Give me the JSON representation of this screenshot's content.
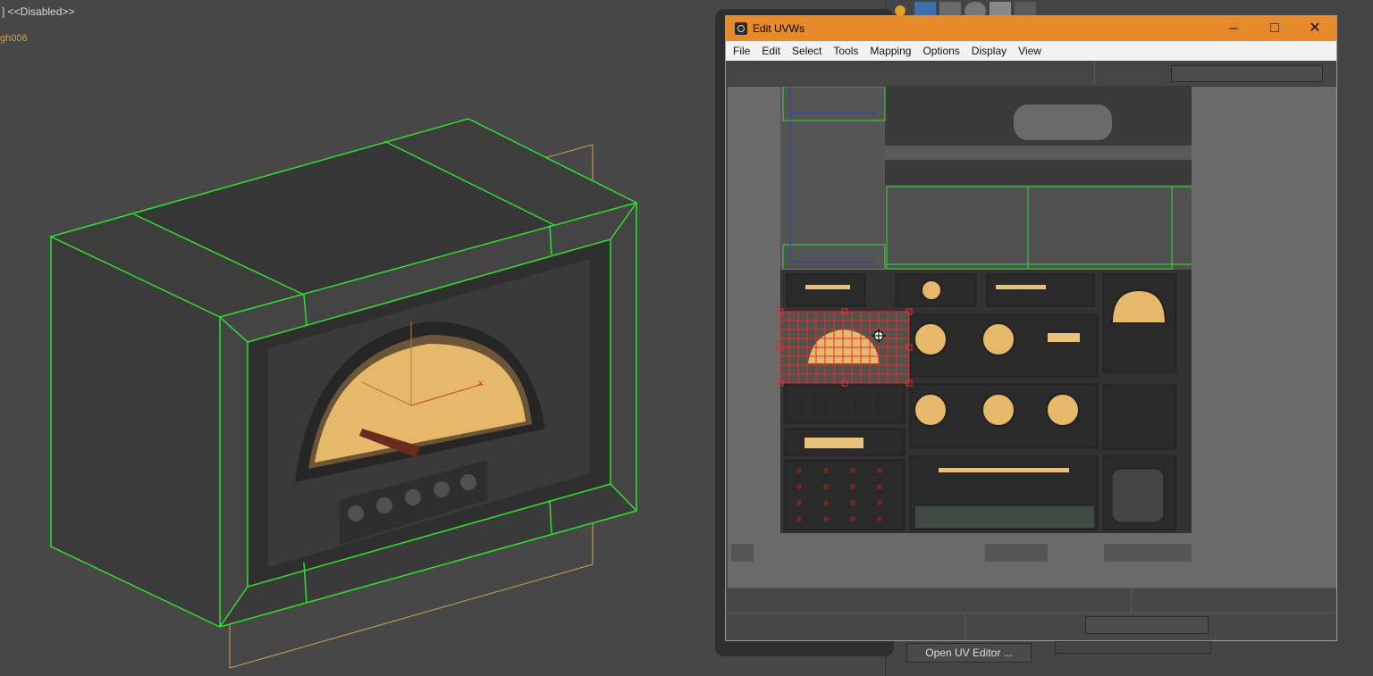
{
  "viewport": {
    "label": "] <<Disabled>>",
    "object_name": "gh006"
  },
  "uvw_window": {
    "title": "Edit UVWs",
    "buttons": {
      "minimize": "–",
      "maximize": "□",
      "close": "✕"
    },
    "menu": [
      "File",
      "Edit",
      "Select",
      "Tools",
      "Mapping",
      "Options",
      "Display",
      "View"
    ]
  },
  "command_panel": {
    "open_uv_editor": "Open UV Editor ..."
  },
  "colors": {
    "title_accent": "#e58b2b",
    "wireframe": "#33dd33",
    "selection": "#e03030",
    "gauge_face": "#e6b86a"
  },
  "icons": [
    "app-icon",
    "move-cursor-icon"
  ]
}
